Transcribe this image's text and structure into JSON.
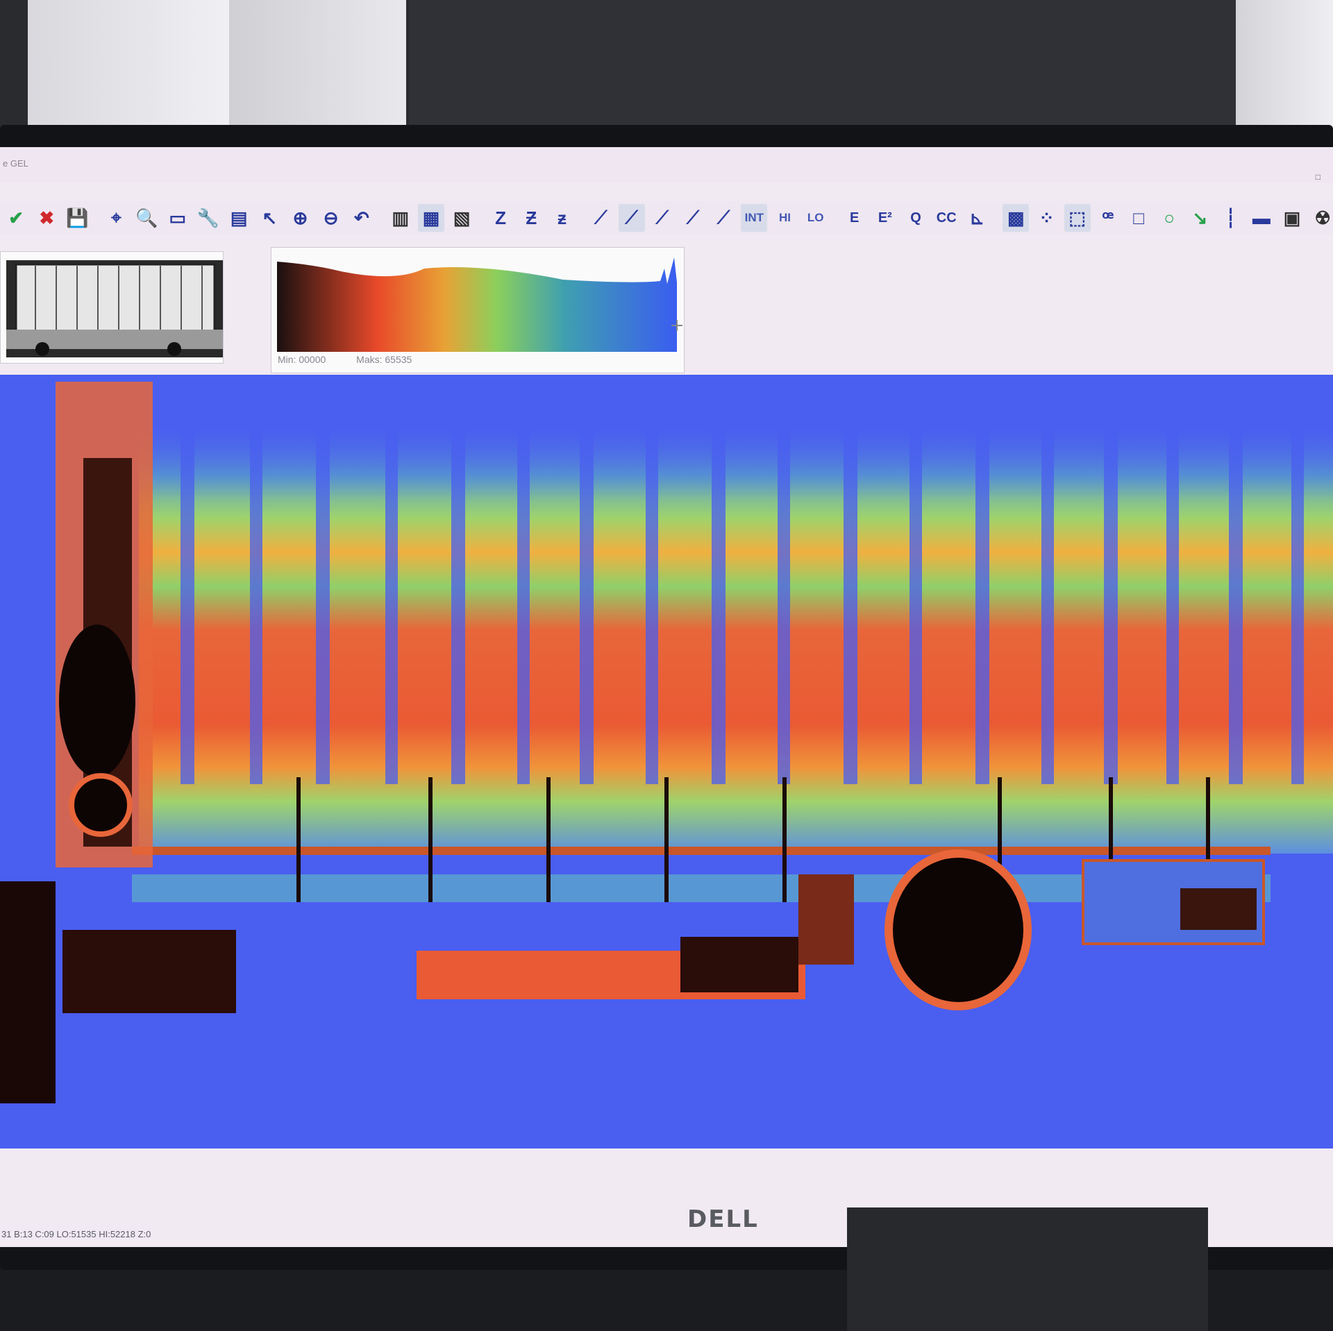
{
  "window": {
    "title": "e GEL",
    "max_glyph": "□"
  },
  "toolbar": {
    "groups": [
      {
        "name": "confirm",
        "items": [
          {
            "icon": "checkmark-icon",
            "glyph": "✔",
            "cls": "green"
          },
          {
            "icon": "cancel-x-icon",
            "glyph": "✖",
            "cls": "red"
          },
          {
            "icon": "save-disk-icon",
            "glyph": "💾",
            "cls": "dark"
          }
        ]
      },
      {
        "name": "navigate",
        "items": [
          {
            "icon": "crosshair-icon",
            "glyph": "⌖"
          },
          {
            "icon": "magnifier-icon",
            "glyph": "🔍"
          },
          {
            "icon": "image-view-icon",
            "glyph": "▭"
          },
          {
            "icon": "tools-icon",
            "glyph": "🔧"
          },
          {
            "icon": "region-icon",
            "glyph": "▤"
          },
          {
            "icon": "pointer-zoom-icon",
            "glyph": "↖"
          },
          {
            "icon": "zoom-in-icon",
            "glyph": "⊕"
          },
          {
            "icon": "zoom-out-icon",
            "glyph": "⊖"
          },
          {
            "icon": "undo-icon",
            "glyph": "↶"
          }
        ]
      },
      {
        "name": "palette",
        "items": [
          {
            "icon": "grayscale-palette-icon",
            "glyph": "▥",
            "cls": "dark"
          },
          {
            "icon": "color-palette-icon",
            "glyph": "▦",
            "cls": "sel"
          },
          {
            "icon": "inverse-palette-icon",
            "glyph": "▧",
            "cls": "dark"
          }
        ]
      },
      {
        "name": "z",
        "items": [
          {
            "icon": "z-icon",
            "glyph": "Z"
          },
          {
            "icon": "z-down-icon",
            "glyph": "Ƶ"
          },
          {
            "icon": "z-up-icon",
            "glyph": "ƶ"
          }
        ]
      },
      {
        "name": "curves",
        "items": [
          {
            "icon": "curve-1-icon",
            "glyph": "⟋"
          },
          {
            "icon": "curve-2-icon",
            "glyph": "⟋",
            "cls": "sel"
          },
          {
            "icon": "curve-3-icon",
            "glyph": "⟋"
          },
          {
            "icon": "curve-4-icon",
            "glyph": "⟋"
          },
          {
            "icon": "curve-5-icon",
            "glyph": "⟋"
          },
          {
            "icon": "int-icon",
            "glyph": "INT",
            "cls": "text-sm sel"
          },
          {
            "icon": "hi-icon",
            "glyph": "HI",
            "cls": "text-sm"
          },
          {
            "icon": "lo-icon",
            "glyph": "LO",
            "cls": "text-sm"
          }
        ]
      },
      {
        "name": "enhance",
        "items": [
          {
            "icon": "e-icon",
            "glyph": "E",
            "cls": "text"
          },
          {
            "icon": "e2-icon",
            "glyph": "E²",
            "cls": "text"
          },
          {
            "icon": "q-icon",
            "glyph": "Q",
            "cls": "text"
          },
          {
            "icon": "cc-icon",
            "glyph": "CC",
            "cls": "text"
          },
          {
            "icon": "axis-icon",
            "glyph": "⊾"
          }
        ]
      },
      {
        "name": "measure",
        "items": [
          {
            "icon": "layers-icon",
            "glyph": "▩",
            "cls": "sel"
          },
          {
            "icon": "grid-icon",
            "glyph": "⁘"
          },
          {
            "icon": "select-icon",
            "glyph": "⬚",
            "cls": "sel"
          },
          {
            "icon": "lasso-icon",
            "glyph": "ꟹ"
          },
          {
            "icon": "rectangle-icon",
            "glyph": "□"
          },
          {
            "icon": "circle-icon",
            "glyph": "○",
            "cls": "green"
          },
          {
            "icon": "arrow-icon",
            "glyph": "↘",
            "cls": "green"
          },
          {
            "icon": "bar-icon",
            "glyph": "┆"
          },
          {
            "icon": "ruler-icon",
            "glyph": "▬"
          },
          {
            "icon": "box-icon",
            "glyph": "▣",
            "cls": "dark"
          },
          {
            "icon": "radiation-icon",
            "glyph": "☢",
            "cls": "dark"
          }
        ]
      }
    ]
  },
  "histogram": {
    "min_label": "Min: 00000",
    "max_label": "Maks: 65535"
  },
  "status_bar": {
    "text": "31 B:13 C:09 LO:51535 HI:52218 Z:0"
  },
  "monitor": {
    "brand": "DELL"
  }
}
